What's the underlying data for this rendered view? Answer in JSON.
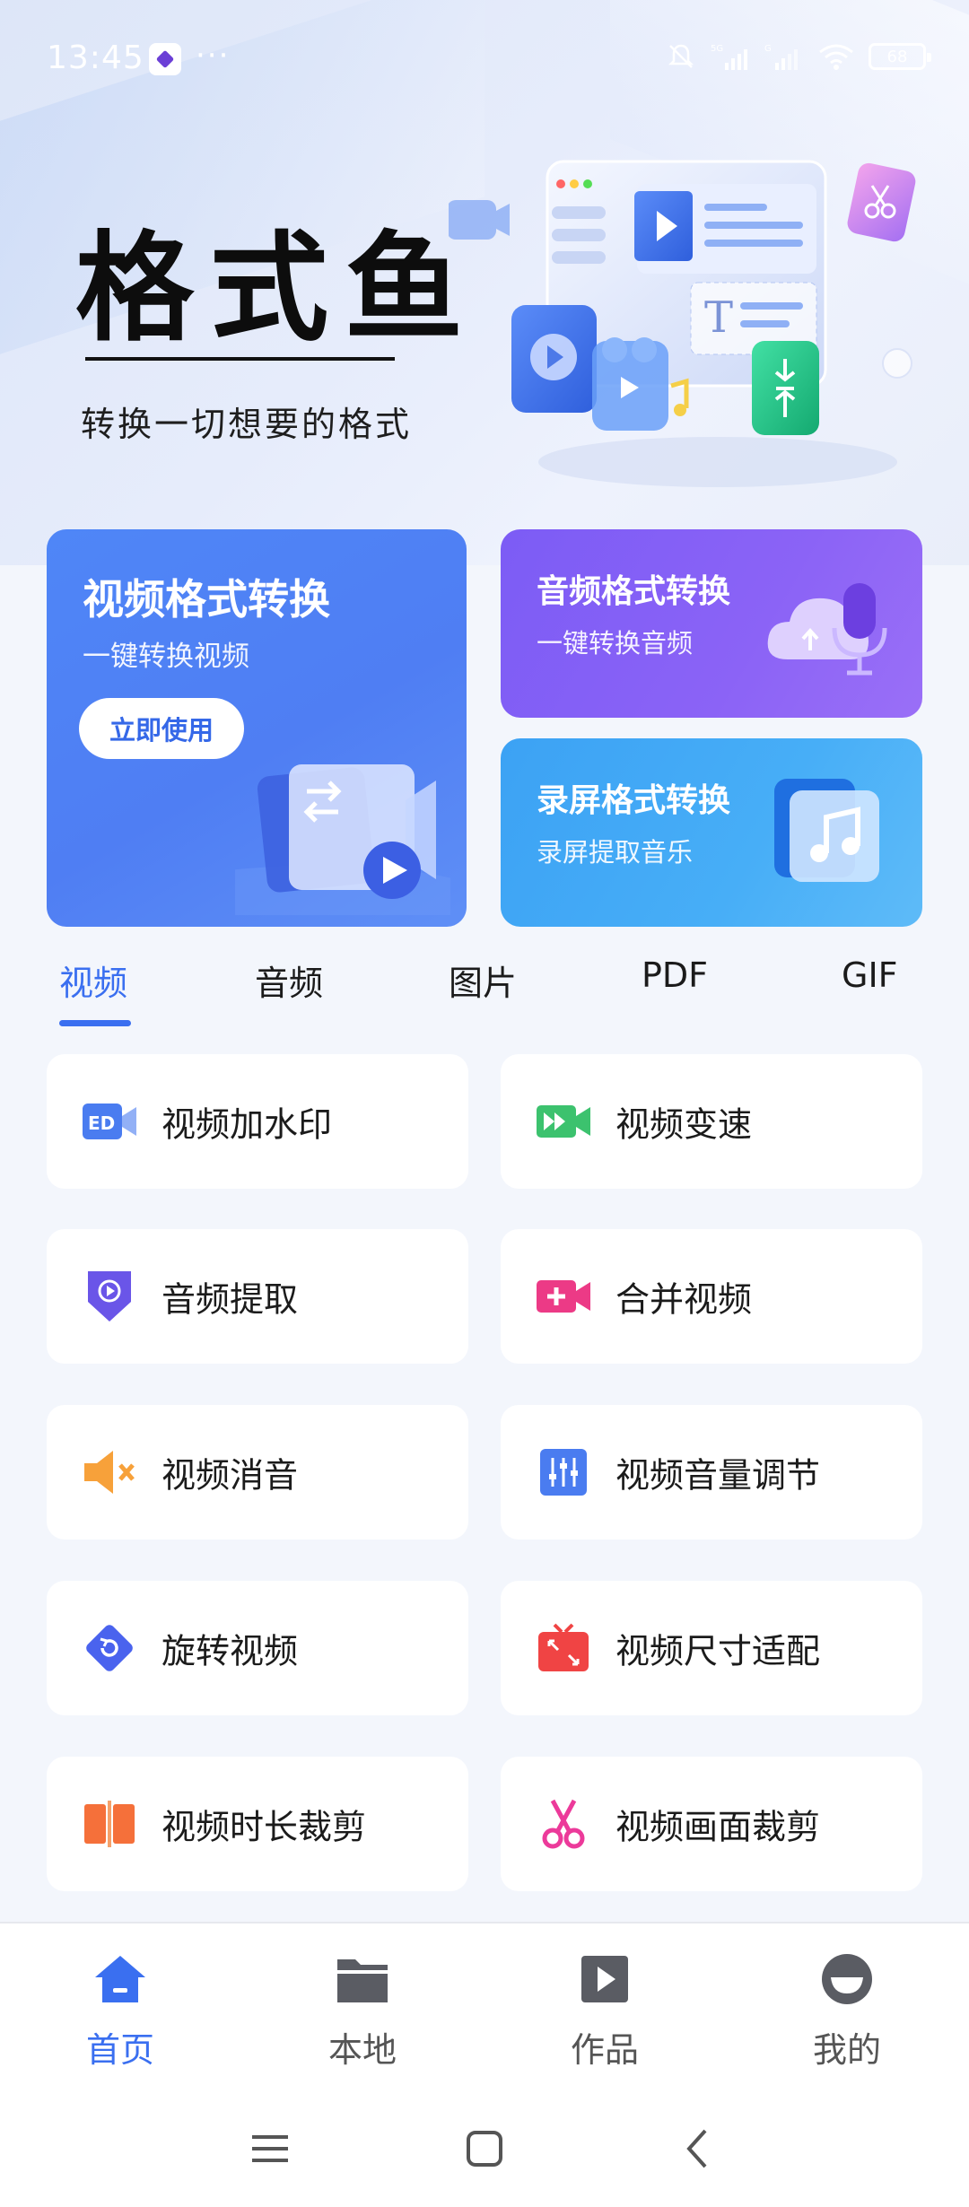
{
  "status_bar": {
    "time": "13:45",
    "more": "···",
    "battery": "68",
    "icons": [
      "app-icon",
      "mute-bell-icon",
      "5g-signal-icon",
      "g-signal-icon",
      "wifi-icon",
      "battery-icon"
    ]
  },
  "banner": {
    "title": "格式鱼",
    "subtitle": "转换一切想要的格式"
  },
  "cards": {
    "video": {
      "title": "视频格式转换",
      "subtitle": "一键转换视频",
      "button": "立即使用"
    },
    "audio": {
      "title": "音频格式转换",
      "subtitle": "一键转换音频"
    },
    "screen": {
      "title": "录屏格式转换",
      "subtitle": "录屏提取音乐"
    }
  },
  "tabs": [
    {
      "label": "视频",
      "active": true
    },
    {
      "label": "音频",
      "active": false
    },
    {
      "label": "图片",
      "active": false
    },
    {
      "label": "PDF",
      "active": false
    },
    {
      "label": "GIF",
      "active": false
    }
  ],
  "tools": [
    {
      "label": "视频加水印",
      "icon": "watermark-icon",
      "color": "#4a7cf0"
    },
    {
      "label": "视频变速",
      "icon": "speed-icon",
      "color": "#3cc26e"
    },
    {
      "label": "音频提取",
      "icon": "audio-extract-icon",
      "color": "#6a55e8"
    },
    {
      "label": "合并视频",
      "icon": "merge-video-icon",
      "color": "#ec3a86"
    },
    {
      "label": "视频消音",
      "icon": "mute-icon",
      "color": "#f7a13a"
    },
    {
      "label": "视频音量调节",
      "icon": "volume-adjust-icon",
      "color": "#4a7cf0"
    },
    {
      "label": "旋转视频",
      "icon": "rotate-icon",
      "color": "#4a63ee"
    },
    {
      "label": "视频尺寸适配",
      "icon": "resize-tv-icon",
      "color": "#f04444"
    },
    {
      "label": "视频时长裁剪",
      "icon": "duration-trim-icon",
      "color": "#f5703a"
    },
    {
      "label": "视频画面裁剪",
      "icon": "scissors-icon",
      "color": "#ec3a9a"
    }
  ],
  "bottom_nav": [
    {
      "label": "首页",
      "icon": "home-icon",
      "active": true
    },
    {
      "label": "本地",
      "icon": "folder-icon",
      "active": false
    },
    {
      "label": "作品",
      "icon": "play-box-icon",
      "active": false
    },
    {
      "label": "我的",
      "icon": "profile-icon",
      "active": false
    }
  ],
  "colors": {
    "accent": "#3a6ff0",
    "video_card": "#4f7ef3",
    "audio_card": "#8b63f6",
    "screen_card": "#47aef7"
  }
}
